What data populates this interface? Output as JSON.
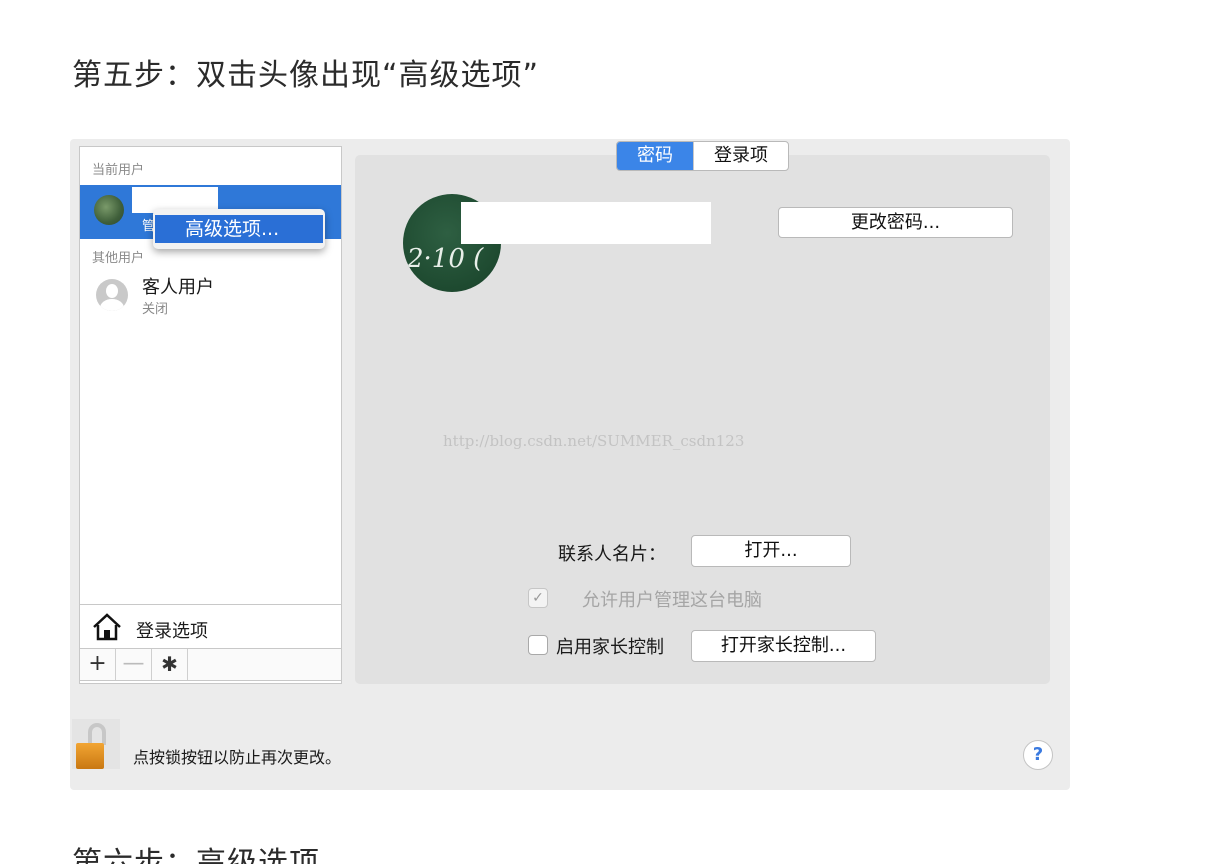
{
  "headings": {
    "step5": "第五步：双击头像出现“高级选项”",
    "step6": "第六步：高级选项"
  },
  "sidebar": {
    "current_users_label": "当前用户",
    "current_user_role_fragment": "管",
    "context_menu_item": "高级选项...",
    "other_users_label": "其他用户",
    "guest": {
      "name": "客人用户",
      "status": "关闭"
    },
    "login_options_label": "登录选项",
    "tools": {
      "add": "+",
      "remove": "—",
      "gear": "✱"
    }
  },
  "tabs": [
    {
      "label": "密码",
      "selected": true
    },
    {
      "label": "登录项",
      "selected": false
    }
  ],
  "avatar_text": "2·10 (",
  "buttons": {
    "change_password": "更改密码...",
    "open": "打开...",
    "open_parental": "打开家长控制..."
  },
  "watermark": "http://blog.csdn.net/SUMMER_csdn123",
  "contact_card_label": "联系人名片：",
  "checkboxes": {
    "admin": {
      "label": "允许用户管理这台电脑",
      "checked": true,
      "disabled": true
    },
    "parental": {
      "label": "启用家长控制",
      "checked": false
    }
  },
  "lock_text": "点按锁按钮以防止再次更改。",
  "help_label": "?",
  "colors": {
    "accent": "#2f78d8",
    "panel": "#e1e1e1",
    "window": "#ececec",
    "lock": "#e89a25"
  },
  "icons": [
    "house-icon",
    "gear-icon",
    "lock-icon",
    "help-icon",
    "guest-avatar-icon"
  ]
}
